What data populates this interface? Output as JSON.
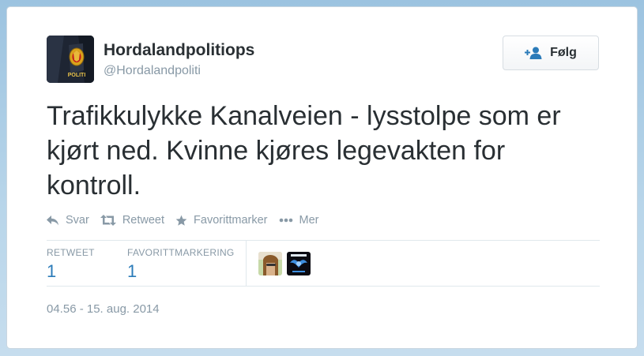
{
  "user": {
    "name": "Hordalandpolitiops",
    "handle": "@Hordalandpoliti",
    "avatar_badge_text": "POLITI"
  },
  "follow_button": {
    "label": "Følg"
  },
  "tweet": {
    "text": "Trafikkulykke Kanalveien - lysstolpe som er kjørt ned. Kvinne kjøres legevakten for kontroll."
  },
  "actions": {
    "reply": "Svar",
    "retweet": "Retweet",
    "favorite": "Favorittmarker",
    "more": "Mer"
  },
  "stats": {
    "retweets_label": "RETWEET",
    "retweets_value": "1",
    "favorites_label": "FAVORITTMARKERING",
    "favorites_value": "1"
  },
  "favoriters": [
    "user-avatar-1",
    "politweet-avatar"
  ],
  "timestamp": "04.56 - 15. aug. 2014",
  "colors": {
    "link": "#2b7bb9",
    "muted": "#8899a6",
    "text": "#292f33"
  }
}
